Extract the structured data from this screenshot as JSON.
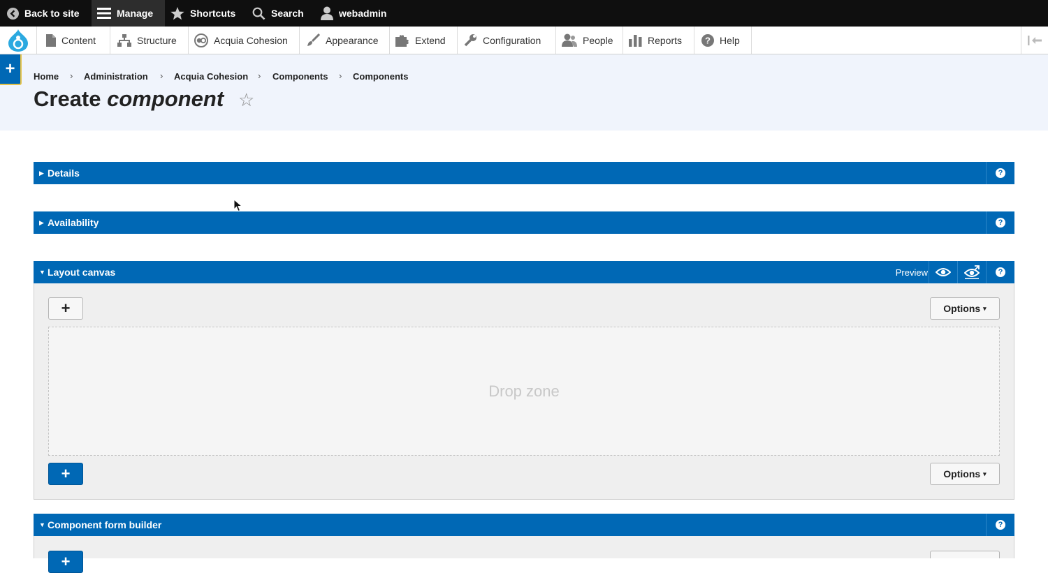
{
  "toolbar": {
    "back_to_site": "Back to site",
    "manage": "Manage",
    "shortcuts": "Shortcuts",
    "search": "Search",
    "user": "webadmin"
  },
  "admin_menu": {
    "items": [
      "Content",
      "Structure",
      "Acquia Cohesion",
      "Appearance",
      "Extend",
      "Configuration",
      "People",
      "Reports",
      "Help"
    ]
  },
  "breadcrumb": [
    "Home",
    "Administration",
    "Acquia Cohesion",
    "Components",
    "Components"
  ],
  "breadcrumb_separator": "›",
  "page": {
    "title_prefix": "Create",
    "title_emphasis": "component",
    "star_glyph": "☆",
    "plus_glyph": "+"
  },
  "sections": {
    "details": "Details",
    "availability": "Availability",
    "layout_canvas": "Layout canvas",
    "form_builder": "Component form builder",
    "help_glyph": "?"
  },
  "canvas": {
    "preview_label": "Preview",
    "add_glyph": "+",
    "options_label": "Options",
    "options_caret": "▾",
    "drop_zone_text": "Drop zone"
  },
  "colors": {
    "toolbar_bg": "#0f0f0f",
    "accent_blue": "#0068b5",
    "header_band": "#f0f4fc",
    "highlight_yellow": "#e5c34a"
  }
}
